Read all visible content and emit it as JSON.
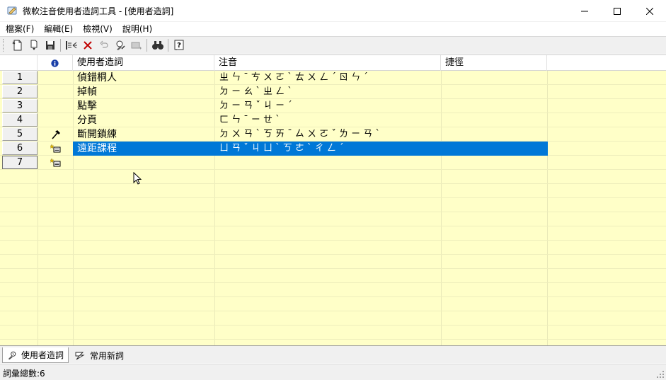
{
  "window": {
    "title": "微軟注音使用者造詞工具 - [使用者造詞]",
    "controls": [
      "minimize-icon",
      "maximize-icon",
      "close-icon"
    ]
  },
  "menu": {
    "items": [
      {
        "label": "檔案(F)"
      },
      {
        "label": "編輯(E)"
      },
      {
        "label": "檢視(V)"
      },
      {
        "label": "說明(H)"
      }
    ]
  },
  "toolbar": {
    "buttons": [
      "new-icon",
      "open-icon",
      "save-icon",
      "import-icon",
      "delete-icon",
      "undo-icon",
      "edit-icon",
      "add-icon",
      "find-icon",
      "help-icon"
    ]
  },
  "grid": {
    "columns": [
      {
        "label": ""
      },
      {
        "label": "使用者造詞"
      },
      {
        "label": "注音"
      },
      {
        "label": "捷徑"
      }
    ],
    "info_icon": "info-icon",
    "rows": [
      {
        "num": "1",
        "phrase": "偵錯桐人",
        "zhuyin": "ㄓ ㄣ ˉ ㄘ ㄨ ㄛ ˋ ㄊ ㄨ ㄥ ˊ ㄖ ㄣ ˊ",
        "shortcut": "",
        "icon": ""
      },
      {
        "num": "2",
        "phrase": "掉幀",
        "zhuyin": "ㄉ ㄧ ㄠ ˋ ㄓ ㄥ ˋ",
        "shortcut": "",
        "icon": ""
      },
      {
        "num": "3",
        "phrase": "點擊",
        "zhuyin": "ㄉ ㄧ ㄢ ˇ ㄐ ㄧ ˊ",
        "shortcut": "",
        "icon": ""
      },
      {
        "num": "4",
        "phrase": "分頁",
        "zhuyin": "ㄈ ㄣ ˉ ㄧ ㄝ ˋ",
        "shortcut": "",
        "icon": ""
      },
      {
        "num": "5",
        "phrase": "斷開鎖練",
        "zhuyin": "ㄉ ㄨ ㄢ ˋ ㄎ ㄞ ˉ ㄙ ㄨ ㄛ ˇ ㄌ ㄧ ㄢ ˋ",
        "shortcut": "",
        "icon": "hammer-icon"
      },
      {
        "num": "6",
        "phrase": "遠距課程",
        "zhuyin": "ㄩ ㄢ ˇ ㄐ ㄩ ˋ ㄎ ㄜ ˋ ㄔ ㄥ ˊ",
        "shortcut": "",
        "icon": "new-word-icon",
        "selected": true
      },
      {
        "num": "7",
        "phrase": "",
        "zhuyin": "",
        "shortcut": "",
        "icon": "new-word-icon",
        "current": true
      }
    ]
  },
  "tabs": [
    {
      "label": "使用者造詞",
      "icon": "user-phrase-icon",
      "active": true
    },
    {
      "label": "常用新詞",
      "icon": "common-words-icon",
      "active": false
    }
  ],
  "status": {
    "text": "詞彙總數:6"
  },
  "colors": {
    "grid_bg": "#ffffc8",
    "selection": "#0078d7",
    "chrome": "#f0f0f0"
  }
}
